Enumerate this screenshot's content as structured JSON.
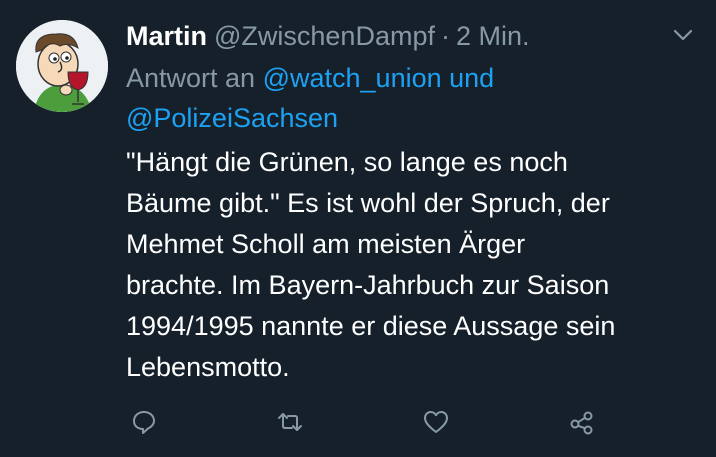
{
  "tweet": {
    "author_name": "Martin",
    "author_handle": "@ZwischenDampf",
    "separator": "·",
    "time": "2 Min.",
    "reply_prefix": "Antwort an",
    "reply_mention_1": "@watch_union und",
    "reply_mention_2": "@PolizeiSachsen",
    "body_lines": [
      "\"Hängt die Grünen, so lange es noch",
      "Bäume gibt.\" Es ist wohl der Spruch, der",
      "Mehmet Scholl am meisten Ärger",
      "brachte. Im Bayern-Jahrbuch zur Saison",
      "1994/1995 nannte er diese Aussage sein",
      "Lebensmotto."
    ]
  },
  "icons": {
    "more": "chevron-down-icon",
    "reply": "comment-icon",
    "retweet": "retweet-icon",
    "like": "heart-icon",
    "share": "share-icon"
  },
  "colors": {
    "background": "#15202b",
    "primary_text": "#ffffff",
    "secondary_text": "#8899a6",
    "accent": "#1da1f2"
  }
}
